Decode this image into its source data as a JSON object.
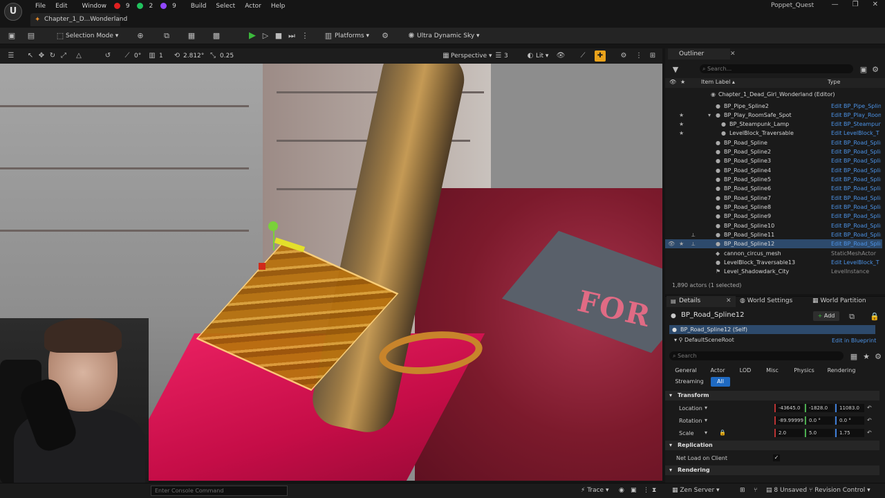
{
  "menu": {
    "items": [
      "File",
      "Edit",
      "Window",
      "Build",
      "Select",
      "Actor",
      "Help"
    ],
    "badges": [
      "9",
      "2",
      "9"
    ],
    "project_tab": "Chapter_1_D...Wonderland",
    "app_name": "Poppet_Quest"
  },
  "toolbar": {
    "selection_mode": "Selection Mode",
    "platforms": "Platforms",
    "sky": "Ultra Dynamic Sky"
  },
  "viewport": {
    "angle": "0°",
    "grid": "1",
    "rotation_snap": "2.812°",
    "scale_snap": "0.25",
    "perspective": "Perspective",
    "camera_speed": "3",
    "lit": "Lit",
    "sign_text": "FOR"
  },
  "outliner": {
    "tab": "Outliner",
    "search_placeholder": "Search...",
    "col_label": "Item Label",
    "col_type": "Type",
    "rows": [
      {
        "label": "Chapter_1_Dead_Girl_Wonderland (Editor)",
        "type": ""
      },
      {
        "label": "BP_Pipe_Spline2",
        "type": "Edit BP_Pipe_Spline"
      },
      {
        "label": "BP_Play_RoomSafe_Spot",
        "type": "Edit BP_Play_Room"
      },
      {
        "label": "BP_Steampunk_Lamp",
        "type": "Edit BP_Steampunk"
      },
      {
        "label": "LevelBlock_Traversable",
        "type": "Edit LevelBlock_T"
      },
      {
        "label": "BP_Road_Spline",
        "type": "Edit BP_Road_Spline"
      },
      {
        "label": "BP_Road_Spline2",
        "type": "Edit BP_Road_Spline"
      },
      {
        "label": "BP_Road_Spline3",
        "type": "Edit BP_Road_Spline"
      },
      {
        "label": "BP_Road_Spline4",
        "type": "Edit BP_Road_Spline"
      },
      {
        "label": "BP_Road_Spline5",
        "type": "Edit BP_Road_Spline"
      },
      {
        "label": "BP_Road_Spline6",
        "type": "Edit BP_Road_Spline"
      },
      {
        "label": "BP_Road_Spline7",
        "type": "Edit BP_Road_Spline"
      },
      {
        "label": "BP_Road_Spline8",
        "type": "Edit BP_Road_Spline"
      },
      {
        "label": "BP_Road_Spline9",
        "type": "Edit BP_Road_Spline"
      },
      {
        "label": "BP_Road_Spline10",
        "type": "Edit BP_Road_Spline"
      },
      {
        "label": "BP_Road_Spline11",
        "type": "Edit BP_Road_Spline"
      },
      {
        "label": "BP_Road_Spline12",
        "type": "Edit BP_Road_Spline"
      },
      {
        "label": "cannon_circus_mesh",
        "type": "StaticMeshActor"
      },
      {
        "label": "LevelBlock_Traversable13",
        "type": "Edit LevelBlock_T"
      },
      {
        "label": "Level_Shadowdark_City",
        "type": "LevelInstance"
      }
    ],
    "footer": "1,890 actors (1 selected)"
  },
  "details": {
    "tabs": [
      "Details",
      "World Settings",
      "World Partition"
    ],
    "actor_name": "BP_Road_Spline12",
    "add_label": "Add",
    "self_label": "BP_Road_Spline12 (Self)",
    "root_label": "DefaultSceneRoot",
    "edit_blueprint": "Edit in Blueprint",
    "search_placeholder": "Search",
    "filters": [
      "General",
      "Actor",
      "LOD",
      "Misc",
      "Physics",
      "Rendering",
      "Streaming",
      "All"
    ],
    "transform": {
      "title": "Transform",
      "location_label": "Location",
      "rotation_label": "Rotation",
      "scale_label": "Scale",
      "location": [
        "-43645.0",
        "-1828.0",
        "11083.0"
      ],
      "rotation": [
        "-89.99999",
        "0.0 °",
        "0.0 °"
      ],
      "scale": [
        "2.0",
        "5.0",
        "1.75"
      ]
    },
    "replication_title": "Replication",
    "net_load_label": "Net Load on Client",
    "rendering_title": "Rendering"
  },
  "status": {
    "console_placeholder": "Enter Console Command",
    "trace": "Trace",
    "zen_server": "Zen Server",
    "unsaved": "8 Unsaved",
    "revision_control": "Revision Control"
  }
}
